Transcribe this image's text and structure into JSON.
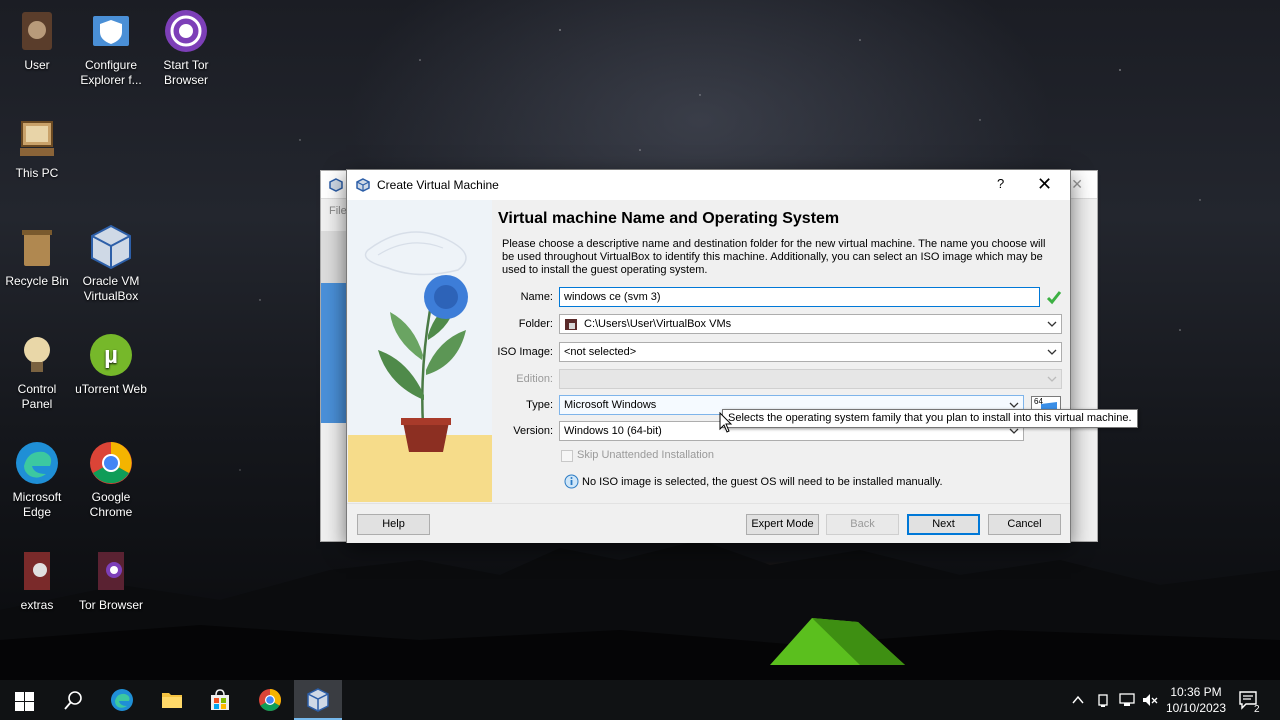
{
  "desktop": {
    "icons": [
      {
        "label": "User"
      },
      {
        "label": "Configure\nExplorer f..."
      },
      {
        "label": "Start Tor\nBrowser"
      },
      {
        "label": "This PC"
      },
      {
        "label": "Recycle Bin"
      },
      {
        "label": "Oracle VM\nVirtualBox"
      },
      {
        "label": "Control\nPanel"
      },
      {
        "label": "uTorrent Web"
      },
      {
        "label": "Microsoft\nEdge"
      },
      {
        "label": "Google\nChrome"
      },
      {
        "label": "extras"
      },
      {
        "label": "Tor Browser"
      }
    ]
  },
  "back_window": {
    "menu": "File"
  },
  "dialog": {
    "title": "Create Virtual Machine",
    "help_glyph": "?",
    "close_glyph": "✕",
    "heading": "Virtual machine Name and Operating System",
    "description": "Please choose a descriptive name and destination folder for the new virtual machine. The name you choose will be used throughout VirtualBox to identify this machine. Additionally, you can select an ISO image which may be used to install the guest operating system.",
    "fields": {
      "name_label": "Name:",
      "name_value": "windows ce (svm 3)",
      "folder_label": "Folder:",
      "folder_value": "C:\\Users\\User\\VirtualBox VMs",
      "iso_label": "ISO Image:",
      "iso_value": "<not selected>",
      "edition_label": "Edition:",
      "edition_value": "",
      "type_label": "Type:",
      "type_value": "Microsoft Windows",
      "version_label": "Version:",
      "version_value": "Windows 10 (64-bit)",
      "os_badge": "64"
    },
    "skip_unattended": "Skip Unattended Installation",
    "info_message": "No ISO image is selected, the guest OS will need to be installed manually.",
    "buttons": {
      "help": "Help",
      "expert": "Expert Mode",
      "back": "Back",
      "next": "Next",
      "cancel": "Cancel"
    }
  },
  "tooltip": "Selects the operating system family that you plan to install into this virtual machine.",
  "taskbar": {
    "time": "10:36 PM",
    "date": "10/10/2023",
    "notification_count": "2"
  },
  "colors": {
    "accent": "#0078d7",
    "valid_check": "#3cb043",
    "taskbar": "#101214"
  }
}
